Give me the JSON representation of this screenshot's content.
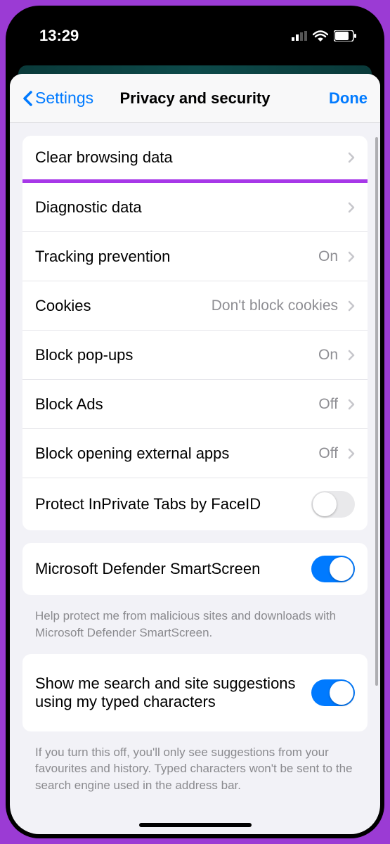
{
  "status": {
    "time": "13:29"
  },
  "nav": {
    "back_label": "Settings",
    "title": "Privacy and security",
    "done_label": "Done"
  },
  "group1": {
    "items": [
      {
        "label": "Clear browsing data",
        "value": "",
        "highlighted": true
      },
      {
        "label": "Diagnostic data",
        "value": ""
      },
      {
        "label": "Tracking prevention",
        "value": "On"
      },
      {
        "label": "Cookies",
        "value": "Don't block cookies"
      },
      {
        "label": "Block pop-ups",
        "value": "On"
      },
      {
        "label": "Block Ads",
        "value": "Off"
      },
      {
        "label": "Block opening external apps",
        "value": "Off"
      },
      {
        "label": "Protect InPrivate Tabs by FaceID",
        "toggle": false
      }
    ]
  },
  "group2": {
    "label": "Microsoft Defender SmartScreen",
    "toggle": true,
    "footer": "Help protect me from malicious sites and downloads with Microsoft Defender SmartScreen."
  },
  "group3": {
    "label": "Show me search and site suggestions using my typed characters",
    "toggle": true,
    "footer": "If you turn this off, you'll only see suggestions from your favourites and history. Typed characters won't be sent to the search engine used in the address bar."
  }
}
